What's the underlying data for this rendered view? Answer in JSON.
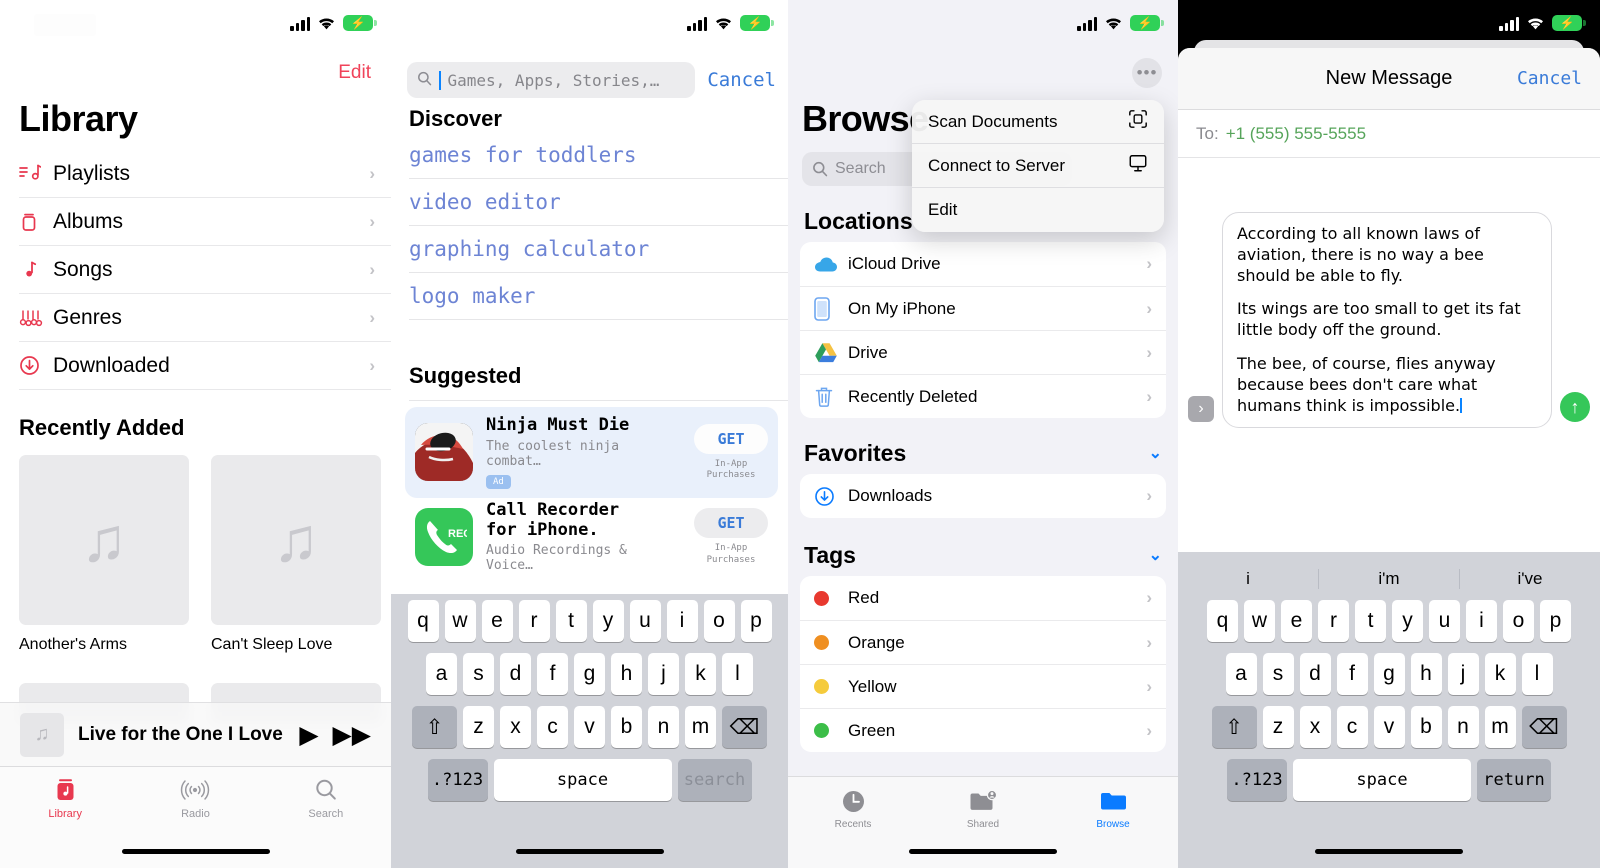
{
  "statusbar": {
    "signal_icon": "cellular-bars-icon",
    "wifi_icon": "wifi-icon",
    "battery_icon": "battery-charging-icon",
    "bolt": "⚡"
  },
  "music": {
    "edit_label": "Edit",
    "title": "Library",
    "items": [
      {
        "label": "Playlists",
        "icon": "playlist-icon",
        "glyph": "≡♪"
      },
      {
        "label": "Albums",
        "icon": "albums-icon",
        "glyph": "▯"
      },
      {
        "label": "Songs",
        "icon": "song-note-icon",
        "glyph": "♪"
      },
      {
        "label": "Genres",
        "icon": "genres-icon",
        "glyph": "♬"
      },
      {
        "label": "Downloaded",
        "icon": "download-circle-icon",
        "glyph": "⭳"
      }
    ],
    "recently_added_label": "Recently Added",
    "albums": [
      {
        "name": "Another's Arms",
        "art_icon": "music-note-placeholder-icon"
      },
      {
        "name": "Can't Sleep Love",
        "art_icon": "music-note-placeholder-icon"
      }
    ],
    "now_playing": {
      "title": "Live for the One I Love",
      "play_icon": "play-icon",
      "next_icon": "fast-forward-icon",
      "art_icon": "music-note-icon"
    },
    "tabs": [
      {
        "label": "Library",
        "icon": "library-icon",
        "active": true
      },
      {
        "label": "Radio",
        "icon": "radio-icon",
        "active": false
      },
      {
        "label": "Search",
        "icon": "search-icon",
        "active": false
      }
    ],
    "accent_color": "#e8384f"
  },
  "appstore": {
    "search_placeholder": "Games, Apps, Stories,…",
    "search_value": "",
    "cancel_label": "Cancel",
    "discover_label": "Discover",
    "discover_items": [
      "games for toddlers",
      "video editor",
      "graphing calculator",
      "logo maker"
    ],
    "suggested_label": "Suggested",
    "apps": [
      {
        "name": "Ninja Must Die",
        "subtitle": "The coolest ninja combat…",
        "badge": "Ad",
        "get_label": "GET",
        "iap_line1": "In-App",
        "iap_line2": "Purchases",
        "icon": "ninja-app-icon"
      },
      {
        "name": "Call Recorder\nfor iPhone.",
        "name_line1": "Call Recorder",
        "name_line2": "for iPhone.",
        "subtitle": "Audio Recordings & Voice…",
        "badge": "",
        "get_label": "GET",
        "iap_line1": "In-App",
        "iap_line2": "Purchases",
        "icon": "call-recorder-app-icon"
      }
    ],
    "keyboard": {
      "row1": [
        "q",
        "w",
        "e",
        "r",
        "t",
        "y",
        "u",
        "i",
        "o",
        "p"
      ],
      "row2": [
        "a",
        "s",
        "d",
        "f",
        "g",
        "h",
        "j",
        "k",
        "l"
      ],
      "row3": [
        "z",
        "x",
        "c",
        "v",
        "b",
        "n",
        "m"
      ],
      "shift": "⇧",
      "backspace": "⌫",
      "numbers": ".?123",
      "space": "space",
      "action": "search"
    },
    "link_color": "#6d84d4"
  },
  "files": {
    "title": "Browse",
    "more_icon": "ellipsis-circle-icon",
    "more_glyph": "•••",
    "search_placeholder": "Search",
    "context_menu": [
      {
        "label": "Scan Documents",
        "icon": "scan-documents-icon"
      },
      {
        "label": "Connect to Server",
        "icon": "server-display-icon"
      },
      {
        "label": "Edit",
        "icon": ""
      }
    ],
    "locations_label": "Locations",
    "locations": [
      {
        "label": "iCloud Drive",
        "icon": "icloud-drive-icon",
        "color": "#3aa8ec"
      },
      {
        "label": "On My iPhone",
        "icon": "iphone-icon",
        "color": "#6da6f0"
      },
      {
        "label": "Drive",
        "icon": "google-drive-icon",
        "color": "#f6c244"
      },
      {
        "label": "Recently Deleted",
        "icon": "trash-icon",
        "color": "#6da6f0"
      }
    ],
    "favorites_label": "Favorites",
    "favorites": [
      {
        "label": "Downloads",
        "icon": "download-circle-icon",
        "color": "#0a7bff"
      }
    ],
    "tags_label": "Tags",
    "tags": [
      {
        "label": "Red",
        "color": "#e8392f"
      },
      {
        "label": "Orange",
        "color": "#ef8f21"
      },
      {
        "label": "Yellow",
        "color": "#f5cb3c"
      },
      {
        "label": "Green",
        "color": "#3cbe48"
      }
    ],
    "chevron_down": "⌄",
    "tabs": [
      {
        "label": "Recents",
        "icon": "clock-icon",
        "active": false
      },
      {
        "label": "Shared",
        "icon": "shared-folder-icon",
        "active": false
      },
      {
        "label": "Browse",
        "icon": "folder-icon",
        "active": true
      }
    ],
    "accent_color": "#0a7bff"
  },
  "messages": {
    "nav_title": "New Message",
    "cancel_label": "Cancel",
    "to_label": "To:",
    "to_value": "+1 (555) 555-5555",
    "compose_paragraphs": [
      "According to all known laws of aviation, there is no way a bee should be able to fly.",
      "Its wings are too small to get its fat little body off the ground.",
      "The bee, of course, flies anyway because bees don't care what humans think is impossible."
    ],
    "expand_icon": "chevron-right-icon",
    "expand_glyph": "›",
    "send_icon": "send-arrow-up-icon",
    "send_glyph": "↑",
    "predictions": [
      "i",
      "i'm",
      "i've"
    ],
    "keyboard": {
      "row1": [
        "q",
        "w",
        "e",
        "r",
        "t",
        "y",
        "u",
        "i",
        "o",
        "p"
      ],
      "row2": [
        "a",
        "s",
        "d",
        "f",
        "g",
        "h",
        "j",
        "k",
        "l"
      ],
      "row3": [
        "z",
        "x",
        "c",
        "v",
        "b",
        "n",
        "m"
      ],
      "shift": "⇧",
      "backspace": "⌫",
      "numbers": ".?123",
      "space": "space",
      "action": "return"
    },
    "send_color": "#35c759"
  }
}
